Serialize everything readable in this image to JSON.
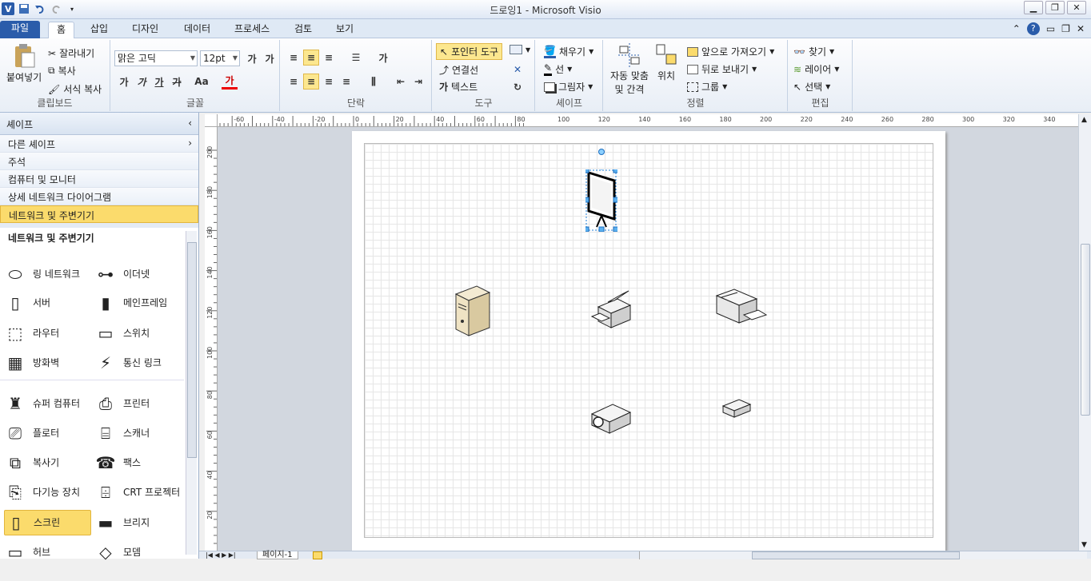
{
  "window": {
    "title": "드로잉1 - Microsoft Visio"
  },
  "tabs": [
    "파일",
    "홈",
    "삽입",
    "디자인",
    "데이터",
    "프로세스",
    "검토",
    "보기"
  ],
  "ribbon": {
    "clipboard": {
      "paste": "붙여넣기",
      "cut": "잘라내기",
      "copy": "복사",
      "format_painter": "서식 복사",
      "label": "클립보드"
    },
    "font": {
      "family": "맑은 고딕",
      "size": "12pt",
      "label": "글꼴",
      "bold": "가",
      "italic": "가",
      "underline": "가",
      "strike": "가",
      "case": "Aa",
      "color": "가"
    },
    "paragraph": {
      "label": "단락"
    },
    "tools": {
      "pointer": "포인터 도구",
      "connector": "연결선",
      "text": "텍스트",
      "label": "도구"
    },
    "shape": {
      "fill": "채우기",
      "line": "선",
      "shadow": "그림자",
      "label": "셰이프"
    },
    "arrange": {
      "auto_align": "자동 맞춤 및 간격",
      "position": "위치",
      "bring_front": "앞으로 가져오기",
      "send_back": "뒤로 보내기",
      "group": "그룹",
      "label": "정렬"
    },
    "editing": {
      "find": "찾기",
      "layer": "레이어",
      "select": "선택",
      "label": "편집"
    }
  },
  "shapes_panel": {
    "title": "셰이프",
    "more_shapes": "다른 셰이프",
    "stencils": [
      "주석",
      "컴퓨터 및 모니터",
      "상세 네트워크 다이어그램",
      "네트워크 및 주변기기"
    ],
    "selected_stencil": "네트워크 및 주변기기",
    "stencil_title": "네트워크 및 주변기기",
    "items": [
      {
        "label": "링 네트워크",
        "icon": "ring-network-icon"
      },
      {
        "label": "이더넷",
        "icon": "ethernet-icon"
      },
      {
        "label": "서버",
        "icon": "server-icon"
      },
      {
        "label": "메인프레임",
        "icon": "mainframe-icon"
      },
      {
        "label": "라우터",
        "icon": "router-icon"
      },
      {
        "label": "스위치",
        "icon": "switch-icon"
      },
      {
        "label": "방화벽",
        "icon": "firewall-icon"
      },
      {
        "label": "통신 링크",
        "icon": "comm-link-icon"
      },
      {
        "label": "슈퍼 컴퓨터",
        "icon": "supercomputer-icon"
      },
      {
        "label": "프린터",
        "icon": "printer-icon"
      },
      {
        "label": "플로터",
        "icon": "plotter-icon"
      },
      {
        "label": "스캐너",
        "icon": "scanner-icon"
      },
      {
        "label": "복사기",
        "icon": "copier-icon"
      },
      {
        "label": "팩스",
        "icon": "fax-icon"
      },
      {
        "label": "다기능 장치",
        "icon": "multifunction-icon"
      },
      {
        "label": "CRT 프로젝터",
        "icon": "crt-projector-icon"
      },
      {
        "label": "스크린",
        "icon": "screen-icon"
      },
      {
        "label": "브리지",
        "icon": "bridge-icon"
      },
      {
        "label": "허브",
        "icon": "hub-icon"
      },
      {
        "label": "모뎀",
        "icon": "modem-icon"
      }
    ]
  },
  "ruler": {
    "h_ticks": [
      "-60",
      "-40",
      "-20",
      "0",
      "20",
      "40",
      "60",
      "80",
      "100",
      "120",
      "140",
      "160",
      "180",
      "200",
      "220",
      "240",
      "260",
      "280",
      "300",
      "320",
      "340"
    ],
    "v_ticks": [
      "200",
      "180",
      "160",
      "140",
      "120",
      "100",
      "80",
      "60",
      "40",
      "20"
    ]
  },
  "canvas": {
    "shapes": [
      "screen",
      "server",
      "printer",
      "multifunction",
      "projector",
      "modem"
    ]
  },
  "status": {
    "page_tab": "페이지-1"
  },
  "colors": {
    "accent": "#2a5caa",
    "selected": "#fbdb6c"
  }
}
